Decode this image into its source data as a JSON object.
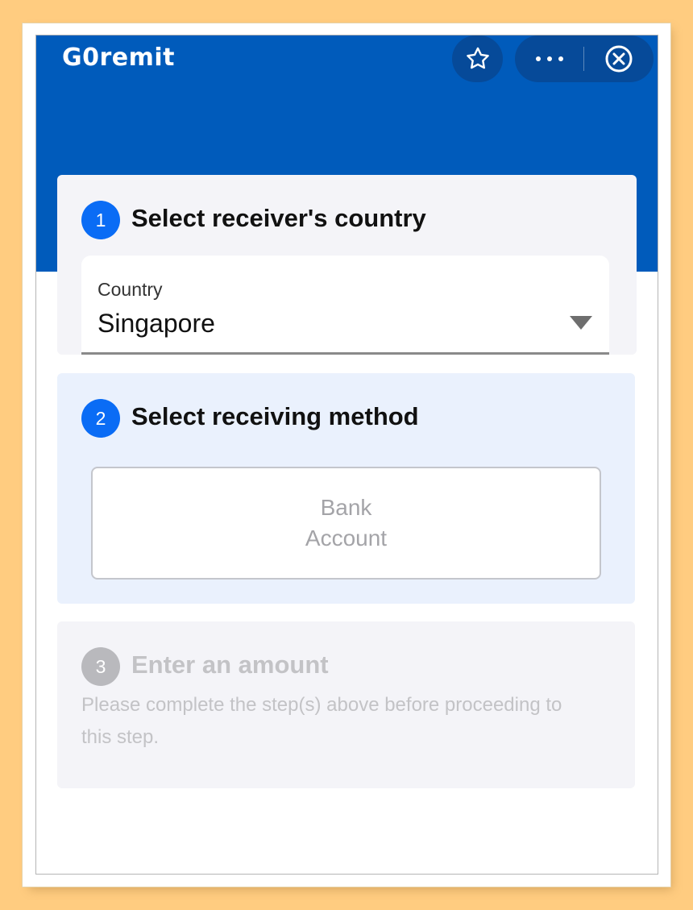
{
  "app": {
    "title": "G0remit",
    "favorite_icon": "star-outline-icon",
    "more_icon": "more-horizontal-icon",
    "close_icon": "close-circle-icon"
  },
  "colors": {
    "brand": "#005bbb",
    "step_active": "#0a6cf5",
    "step_disabled": "#b9b9bd",
    "page_background": "#ffcc80"
  },
  "steps": [
    {
      "number": "1",
      "title": "Select receiver's country",
      "state": "active",
      "field": {
        "label": "Country",
        "value": "Singapore",
        "control": "dropdown"
      }
    },
    {
      "number": "2",
      "title": "Select receiving method",
      "state": "active",
      "options": [
        {
          "label": "Bank Account",
          "selected": false
        }
      ]
    },
    {
      "number": "3",
      "title": "Enter an amount",
      "state": "disabled",
      "hint": "Please complete the step(s) above before proceeding to this step."
    }
  ]
}
